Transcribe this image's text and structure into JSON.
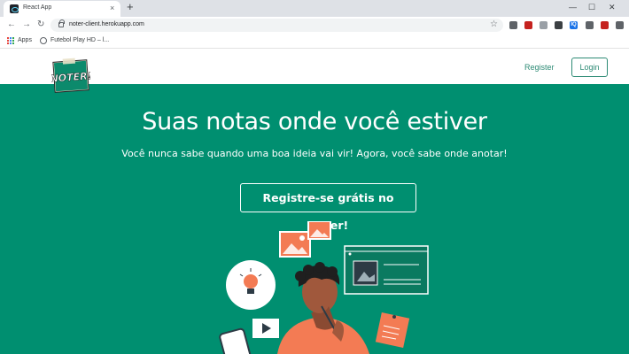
{
  "browser": {
    "tab_title": "React App",
    "tab_close": "×",
    "new_tab": "+",
    "url": "noter-client.herokuapp.com",
    "nav": {
      "back": "←",
      "forward": "→",
      "reload": "↻"
    },
    "star": "☆",
    "window_controls": {
      "minimize": "—",
      "maximize": "☐",
      "close": "✕"
    },
    "extensions": [
      {
        "name": "globe-ext-icon",
        "color": "#5f6368",
        "glyph": ""
      },
      {
        "name": "pdf-ext-icon",
        "color": "#c5221f",
        "glyph": ""
      },
      {
        "name": "grid-ext-icon",
        "color": "#9aa0a6",
        "glyph": ""
      },
      {
        "name": "tool-ext-icon",
        "color": "#3c4043",
        "glyph": ""
      },
      {
        "name": "iq-ext-icon",
        "color": "#1a73e8",
        "glyph": "IQ"
      },
      {
        "name": "check-ext-icon",
        "color": "#5f6368",
        "glyph": ""
      },
      {
        "name": "record-ext-icon",
        "color": "#c5221f",
        "glyph": ""
      },
      {
        "name": "puzzle-ext-icon",
        "color": "#5f6368",
        "glyph": ""
      },
      {
        "name": "media-ext-icon",
        "color": "#5f6368",
        "glyph": ""
      }
    ]
  },
  "bookmarks": [
    {
      "label": "Apps"
    },
    {
      "label": "Futebol Play HD – l..."
    }
  ],
  "header": {
    "logo_text": "NOTER!",
    "register": "Register",
    "login": "Login"
  },
  "hero": {
    "title": "Suas notas onde você estiver",
    "subtitle": "Você nunca sabe quando uma boa ideia vai vir! Agora, você sabe onde anotar!",
    "cta": "Registre-se grátis no Noter!"
  },
  "colors": {
    "brand": "#008f70",
    "accent_link": "#2e8b75",
    "illustration_orange": "#f37b54"
  }
}
